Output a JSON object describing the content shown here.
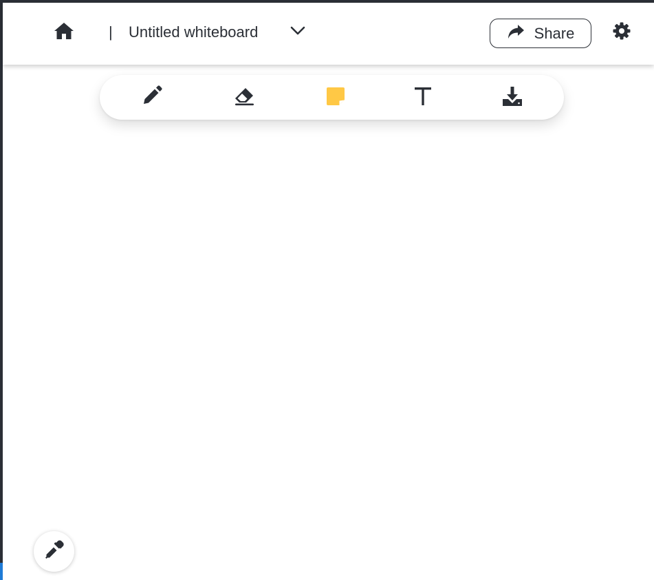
{
  "header": {
    "home_icon": "home-icon",
    "separator": "|",
    "title": "Untitled whiteboard",
    "title_menu_icon": "chevron-down-icon",
    "share_label": "Share",
    "share_icon": "share-arrow-icon",
    "settings_icon": "gear-icon"
  },
  "toolbar": {
    "tools": [
      {
        "name": "pencil",
        "icon": "pencil-icon"
      },
      {
        "name": "eraser",
        "icon": "eraser-icon"
      },
      {
        "name": "sticky-note",
        "icon": "sticky-note-icon",
        "color": "#ffc845"
      },
      {
        "name": "text",
        "icon": "text-icon"
      },
      {
        "name": "download",
        "icon": "download-icon"
      }
    ]
  },
  "color_picker": {
    "icon": "eyedropper-icon"
  },
  "colors": {
    "foreground": "#2b2f36",
    "accent_note": "#ffc845",
    "frame": "#2b2f36",
    "frame_accent": "#1f7bd6"
  }
}
